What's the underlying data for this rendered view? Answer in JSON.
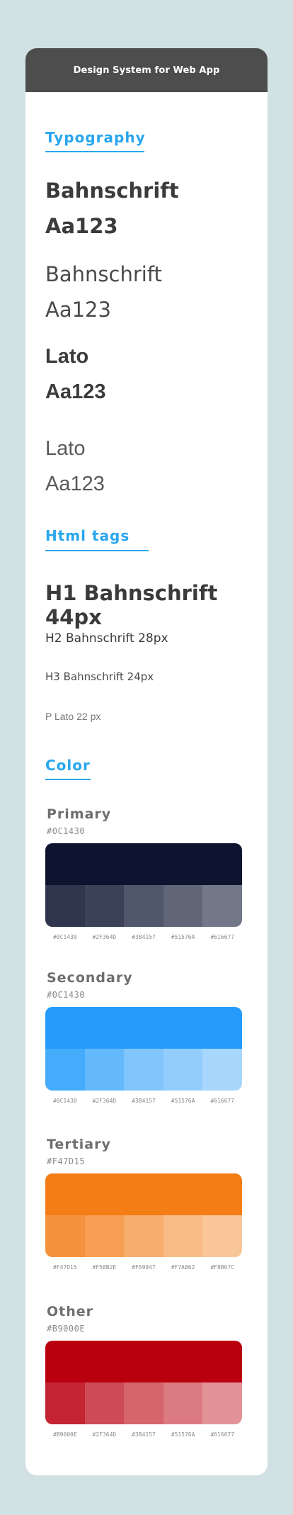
{
  "header": {
    "title": "Design System for Web App"
  },
  "typography": {
    "title": "Typography",
    "samples": [
      {
        "name": "Bahnschrift",
        "sample": "Aa123"
      },
      {
        "name": "Bahnschrift",
        "sample": "Aa123"
      },
      {
        "name": "Lato",
        "sample": "Aa123"
      },
      {
        "name": "Lato",
        "sample": "Aa123"
      }
    ]
  },
  "html_tags": {
    "title": "Html tags",
    "h1": "H1 Bahnschrift 44px",
    "h2": "H2 Bahnschrift 28px",
    "h3": "H3 Bahnschrift 24px",
    "p": "P Lato 22 px"
  },
  "color": {
    "title": "Color",
    "groups": [
      {
        "name": "Primary",
        "hex": "#0C1430",
        "main": "#0c1430",
        "shades": [
          "#2f364d",
          "#3b4157",
          "#51576a",
          "#616677",
          "#737888"
        ],
        "labels": [
          "#0C1430",
          "#2F364D",
          "#3B4157",
          "#51576A",
          "#616677"
        ]
      },
      {
        "name": "Secondary",
        "hex": "#0C1430",
        "main": "#259cfb",
        "shades": [
          "#45abfb",
          "#64b9fc",
          "#81c5fc",
          "#93cdfd",
          "#a8d7fd"
        ],
        "labels": [
          "#0C1430",
          "#2F364D",
          "#3B4157",
          "#51576A",
          "#616677"
        ]
      },
      {
        "name": "Tertiary",
        "hex": "#F47D15",
        "main": "#f47d15",
        "shades": [
          "#f5923e",
          "#f69f52",
          "#f7ad6e",
          "#f8bb87",
          "#f9c699"
        ],
        "labels": [
          "#F47D15",
          "#F58B2E",
          "#F69947",
          "#F7A862",
          "#F8B67C"
        ]
      },
      {
        "name": "Other",
        "hex": "#B9000E",
        "main": "#b9000e",
        "shades": [
          "#c42332",
          "#cd4b56",
          "#d6646d",
          "#dc7a82",
          "#e39397"
        ],
        "labels": [
          "#B9000E",
          "#2F364D",
          "#3B4157",
          "#51576A",
          "#616677"
        ]
      }
    ]
  }
}
